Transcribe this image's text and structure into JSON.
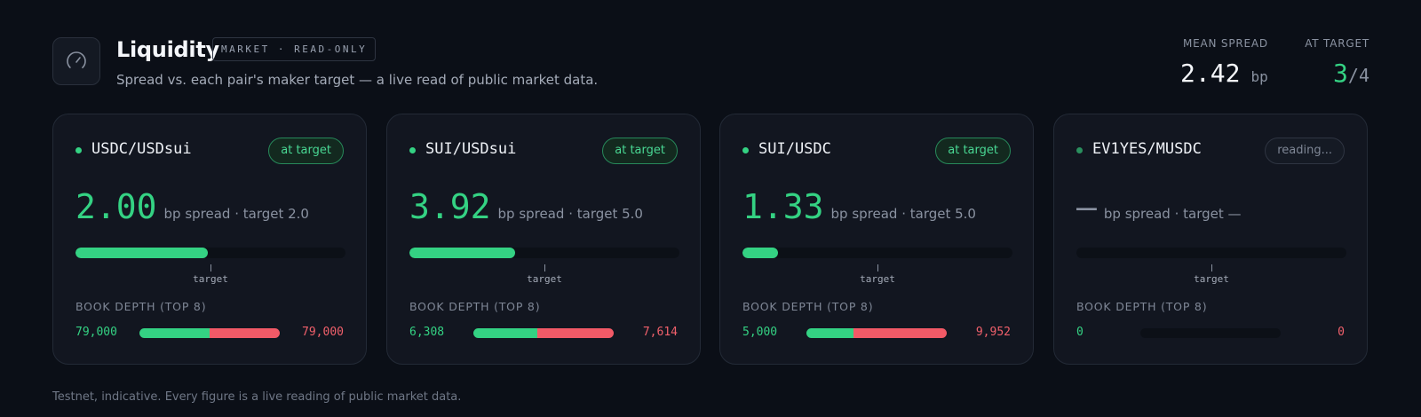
{
  "header": {
    "title": "Liquidity",
    "tag": "MARKET · READ-ONLY",
    "subtitle": "Spread vs. each pair's maker target — a live read of public market data.",
    "icon": "gauge-icon"
  },
  "stats": {
    "mean_spread_label": "MEAN SPREAD",
    "mean_spread_value": "2.42",
    "mean_spread_unit": "bp",
    "at_target_label": "AT TARGET",
    "at_target_count": "3",
    "at_target_total": "/4"
  },
  "colors": {
    "accent_green": "#34d283",
    "ask_red": "#f25a67",
    "background": "#0b0f17",
    "card": "#121620"
  },
  "cards": [
    {
      "pair": "USDC/USDsui",
      "badge": "at target",
      "status": "ok",
      "spread": "2.00",
      "spread_desc": "bp spread · target 2.0",
      "spread_fill": 0.49,
      "tick_label": "target",
      "depth_label": "BOOK DEPTH (TOP 8)",
      "depth_bid": "79,000",
      "depth_ask": "79,000",
      "bid_share": 0.5
    },
    {
      "pair": "SUI/USDsui",
      "badge": "at target",
      "status": "ok",
      "spread": "3.92",
      "spread_desc": "bp spread · target 5.0",
      "spread_fill": 0.39,
      "tick_label": "target",
      "depth_label": "BOOK DEPTH (TOP 8)",
      "depth_bid": "6,308",
      "depth_ask": "7,614",
      "bid_share": 0.453
    },
    {
      "pair": "SUI/USDC",
      "badge": "at target",
      "status": "ok",
      "spread": "1.33",
      "spread_desc": "bp spread · target 5.0",
      "spread_fill": 0.13,
      "tick_label": "target",
      "depth_label": "BOOK DEPTH (TOP 8)",
      "depth_bid": "5,000",
      "depth_ask": "9,952",
      "bid_share": 0.334
    },
    {
      "pair": "EV1YES/MUSDC",
      "badge": "reading...",
      "status": "pending",
      "spread": "—",
      "spread_desc": "bp spread · target —",
      "spread_fill": 0,
      "tick_label": "target",
      "depth_label": "BOOK DEPTH (TOP 8)",
      "depth_bid": "0",
      "depth_ask": "0",
      "bid_share": 0
    }
  ],
  "footer": "Testnet, indicative. Every figure is a live reading of public market data."
}
